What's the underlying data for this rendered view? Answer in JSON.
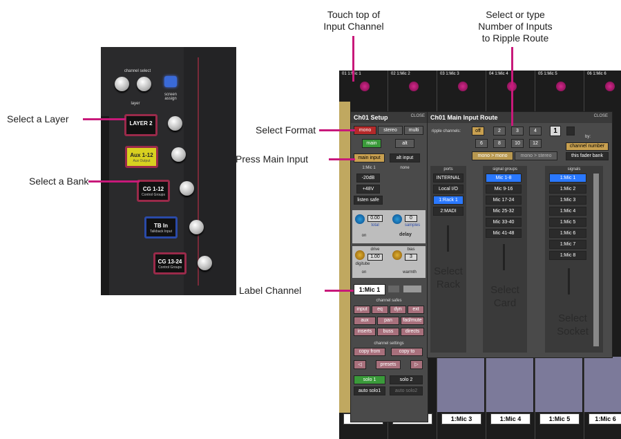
{
  "callouts": {
    "touch_top": "Touch top of\nInput Channel",
    "select_number": "Select or type\nNumber of Inputs\nto Ripple Route",
    "select_layer": "Select a Layer",
    "select_bank": "Select a Bank",
    "select_format": "Select Format",
    "press_main": "Press Main Input",
    "label_channel": "Label Channel"
  },
  "hardware": {
    "channel_select": "channel select",
    "layer_label": "layer",
    "screen_assign": "screen assign",
    "keys": [
      {
        "label": "LAYER 2",
        "sub": ""
      },
      {
        "label": "Aux 1-12",
        "sub": "Aux Output"
      },
      {
        "label": "CG 1-12",
        "sub": "Control Groups"
      },
      {
        "label": "TB In",
        "sub": "Talkback Input"
      },
      {
        "label": "CG 13-24",
        "sub": "Control Groups"
      }
    ]
  },
  "strips": [
    {
      "name": "01 1:Mic 1",
      "label": "1:Mic 1"
    },
    {
      "name": "02 1:Mic 2",
      "label": "1:Mic 2"
    },
    {
      "name": "03 1:Mic 3",
      "label": "1:Mic 3"
    },
    {
      "name": "04 1:Mic 4",
      "label": "1:Mic 4"
    },
    {
      "name": "05 1:Mic 5",
      "label": "1:Mic 5"
    },
    {
      "name": "06 1:Mic 6",
      "label": "1:Mic 6"
    }
  ],
  "setup": {
    "title": "Ch01 Setup",
    "close": "CLOSE",
    "formats": [
      "mono",
      "stereo",
      "multi"
    ],
    "main": "main",
    "alt": "alt",
    "main_input": "main input",
    "alt_input": "alt input",
    "source": "1:Mic 1",
    "none": "none",
    "pad": "-20dB",
    "phantom": "+48V",
    "listen_safe": "listen safe",
    "trim_value": "0.00",
    "trim_label": "total",
    "delay_value": "0",
    "delay_unit": "samples",
    "delay": "delay",
    "on": "on",
    "drive": "drive",
    "drive_value": "1.00",
    "bias": "bias",
    "bias_value": "3",
    "digitube": "digitube",
    "warmth": "warmth",
    "channel_label": "1:Mic 1",
    "channel_safes": "channel safes",
    "safes_row1": [
      "input",
      "eq",
      "dyn",
      "ext"
    ],
    "safes_row2": [
      "aux",
      "pan",
      "fad/mute"
    ],
    "safes_row3": [
      "inserts",
      "buss",
      "directs"
    ],
    "channel_settings": "channel settings",
    "copy_from": "copy from",
    "copy_to": "copy to",
    "presets": "presets",
    "solo1": "solo 1",
    "solo2": "solo 2",
    "auto_solo1": "auto solo1",
    "auto_solo2": "auto solo2"
  },
  "route": {
    "title": "Ch01 Main Input Route",
    "close": "CLOSE",
    "ripple_label": "ripple channels:",
    "ripple_row1": [
      "off",
      "2",
      "3",
      "4"
    ],
    "ripple_value": "1",
    "ripple_row2": [
      "6",
      "8",
      "10",
      "12"
    ],
    "by_label": "by:",
    "by_options": [
      "channel number",
      "this fader bank"
    ],
    "mono_mono": "mono > mono",
    "mono_stereo": "mono > stereo",
    "ports_header": "ports",
    "ports": [
      "INTERNAL",
      "Local I/O",
      "1:Rack 1",
      "2:MADI"
    ],
    "groups_header": "signal groups",
    "groups": [
      "Mic 1-8",
      "Mic 9-16",
      "Mic 17-24",
      "Mic 25-32",
      "Mic 33-40",
      "Mic 41-48"
    ],
    "signals_header": "signals",
    "signals": [
      "1:Mic 1",
      "1:Mic 2",
      "1:Mic 3",
      "1:Mic 4",
      "1:Mic 5",
      "1:Mic 6",
      "1:Mic 7",
      "1:Mic 8"
    ],
    "select_rack": "Select\nRack",
    "select_card": "Select\nCard",
    "select_socket": "Select\nSocket"
  },
  "colors": {
    "accent": "#c8197a",
    "selected_blue": "#2a78ff",
    "mono_red": "#b42a2a",
    "main_green": "#3a9a3a"
  }
}
